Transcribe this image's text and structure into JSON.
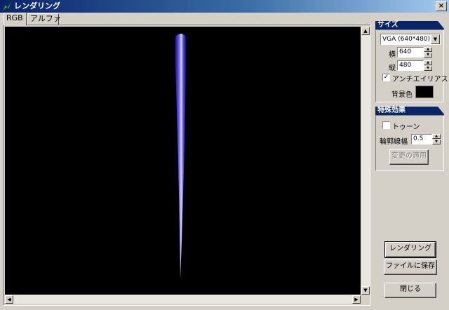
{
  "window": {
    "title": "レンダリング",
    "close_label": "×"
  },
  "tabs": [
    {
      "label": "RGB",
      "active": true
    },
    {
      "label": "アルファ",
      "active": false
    }
  ],
  "scroll": {
    "up": "▲",
    "down": "▼",
    "left": "◀",
    "right": "▶"
  },
  "size_group": {
    "header": "サイズ",
    "preset": "VGA (640*480)",
    "width_label": "横",
    "width_value": "640",
    "height_label": "縦",
    "height_value": "480",
    "antialias_label": "アンチエイリアス",
    "antialias_checked": true,
    "check_mark": "✓",
    "bg_label": "背景色",
    "bg_color": "#000000"
  },
  "effects_group": {
    "header": "特殊効果",
    "toon_label": "トゥーン",
    "toon_checked": false,
    "outline_label": "輪郭線幅",
    "outline_value": "0.5",
    "apply_label": "変更の適用"
  },
  "actions": {
    "render": "レンダリング",
    "save": "ファイルに保存",
    "close": "閉じる"
  },
  "colors": {
    "title_bar": "#0a246a",
    "object": "#5a4ce0"
  }
}
